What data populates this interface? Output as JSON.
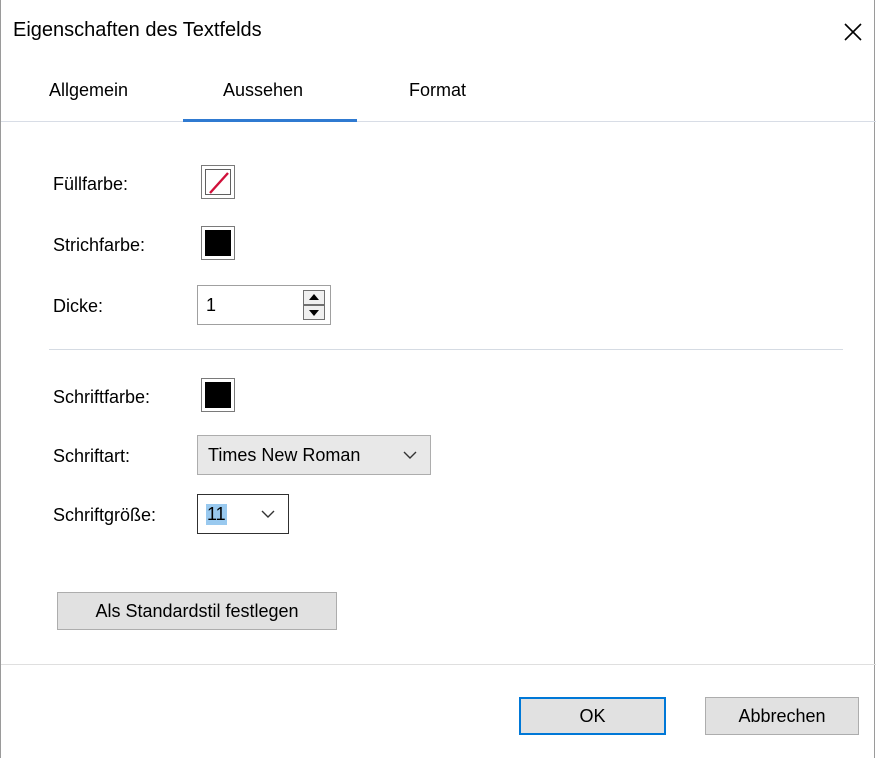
{
  "dialog": {
    "title": "Eigenschaften des Textfelds"
  },
  "tabs": [
    {
      "label": "Allgemein"
    },
    {
      "label": "Aussehen",
      "selected": true
    },
    {
      "label": "Format"
    }
  ],
  "appearance": {
    "fill_label": "Füllfarbe:",
    "fill_color": "none",
    "stroke_label": "Strichfarbe:",
    "stroke_color": "#000000",
    "thickness_label": "Dicke:",
    "thickness_value": "1"
  },
  "font": {
    "color_label": "Schriftfarbe:",
    "color": "#000000",
    "family_label": "Schriftart:",
    "family_value": "Times New Roman",
    "size_label": "Schriftgröße:",
    "size_value": "11"
  },
  "buttons": {
    "set_default": "Als Standardstil festlegen",
    "ok": "OK",
    "cancel": "Abbrechen"
  },
  "icons": {
    "close": "close-icon",
    "spin_up": "triangle-up-icon",
    "spin_down": "triangle-down-icon",
    "dropdown": "chevron-down-icon",
    "no_fill": "no-fill-slash-icon"
  },
  "colors": {
    "tab_accent": "#2f7ad1",
    "default_button_border": "#0078d7",
    "selection_highlight": "#99c9ef",
    "no_fill_slash": "#d0103a"
  }
}
